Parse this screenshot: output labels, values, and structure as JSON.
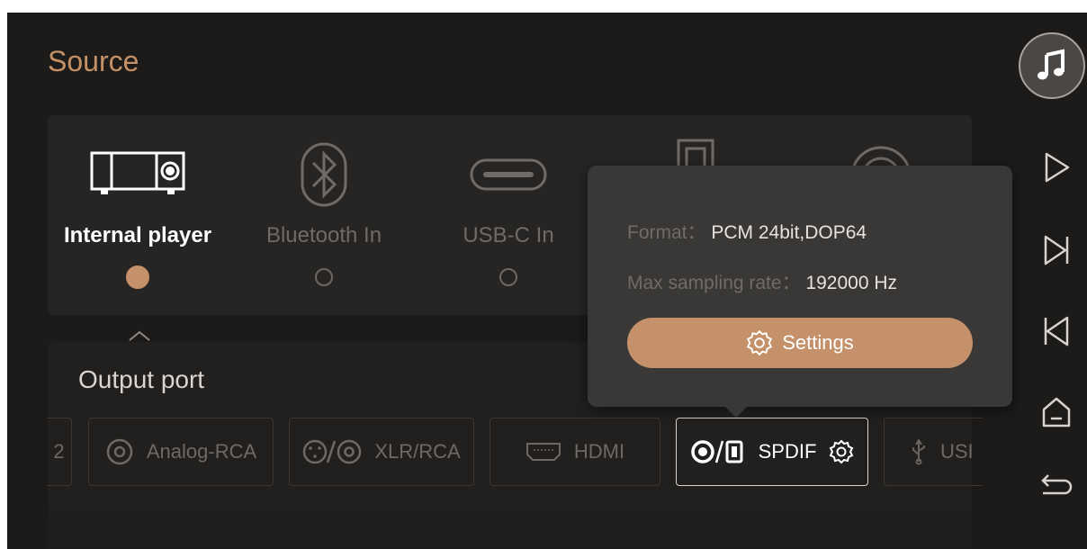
{
  "page": {
    "title": "Source"
  },
  "sources": [
    {
      "label": "Internal player",
      "icon": "internal-player-icon",
      "selected": true
    },
    {
      "label": "Bluetooth In",
      "icon": "bluetooth-icon",
      "selected": false
    },
    {
      "label": "USB-C In",
      "icon": "usb-c-icon",
      "selected": false
    },
    {
      "label": "",
      "icon": "optical-input-icon",
      "selected": false
    },
    {
      "label": "",
      "icon": "coaxial-input-icon",
      "selected": false
    }
  ],
  "output": {
    "title": "Output port",
    "ports": [
      {
        "label": "2",
        "icon": "",
        "active": false
      },
      {
        "label": "Analog-RCA",
        "icon": "rca-icon",
        "active": false
      },
      {
        "label": "XLR/RCA",
        "icon": "xlr-rca-icon",
        "active": false
      },
      {
        "label": "HDMI",
        "icon": "hdmi-icon",
        "active": false
      },
      {
        "label": "SPDIF",
        "icon": "spdif-icon",
        "active": true
      },
      {
        "label": "USI",
        "icon": "usb-icon",
        "active": false
      }
    ]
  },
  "popup": {
    "format_key": "Format：",
    "format_value": "PCM 24bit,DOP64",
    "rate_key": "Max sampling rate：",
    "rate_value": "192000 Hz",
    "settings_label": "Settings"
  },
  "sidebar": {
    "icons": [
      "music-note-icon",
      "play-icon",
      "next-track-icon",
      "previous-track-icon",
      "home-icon",
      "back-icon"
    ]
  },
  "colors": {
    "accent": "#c4916a",
    "title": "#c49066",
    "background": "#1d1b19"
  }
}
